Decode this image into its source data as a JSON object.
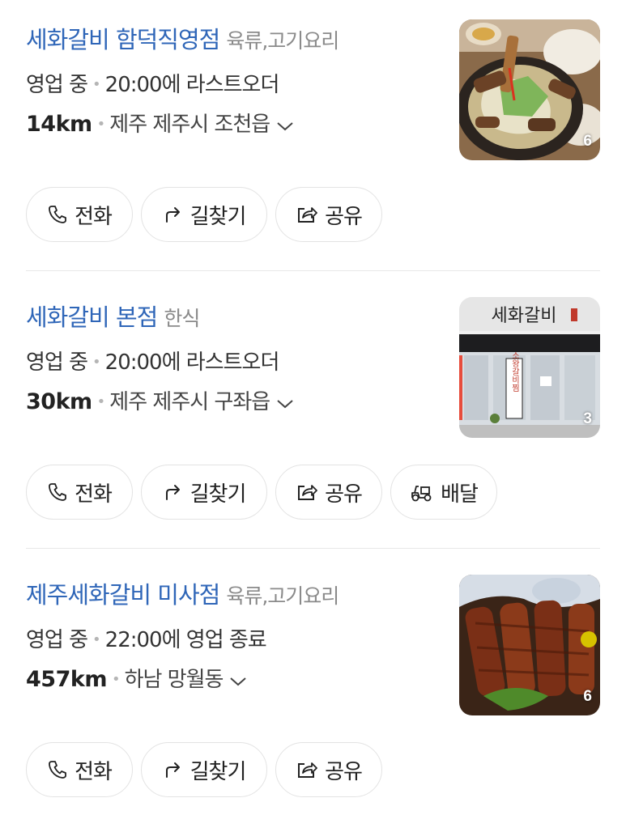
{
  "places": [
    {
      "name": "세화갈비 함덕직영점",
      "category": "육류,고기요리",
      "status": "영업 중",
      "hours_note": "20:00에 라스트오더",
      "distance": "14km",
      "address": "제주 제주시 조천읍",
      "photo_count": "6",
      "buttons": [
        "전화",
        "길찾기",
        "공유"
      ]
    },
    {
      "name": "세화갈비 본점",
      "category": "한식",
      "status": "영업 중",
      "hours_note": "20:00에 라스트오더",
      "distance": "30km",
      "address": "제주 제주시 구좌읍",
      "photo_count": "3",
      "sign_text": "세화갈비",
      "banner_text": "소왕갈비찜",
      "buttons": [
        "전화",
        "길찾기",
        "공유",
        "배달"
      ]
    },
    {
      "name": "제주세화갈비 미사점",
      "category": "육류,고기요리",
      "status": "영업 중",
      "hours_note": "22:00에 영업 종료",
      "distance": "457km",
      "address": "하남 망월동",
      "photo_count": "6",
      "buttons": [
        "전화",
        "길찾기",
        "공유"
      ]
    }
  ],
  "colors": {
    "name_link": "#2f66b8",
    "category": "#8a8a8a",
    "divider": "#e8e8e8",
    "button_border": "#e3e3e3"
  }
}
